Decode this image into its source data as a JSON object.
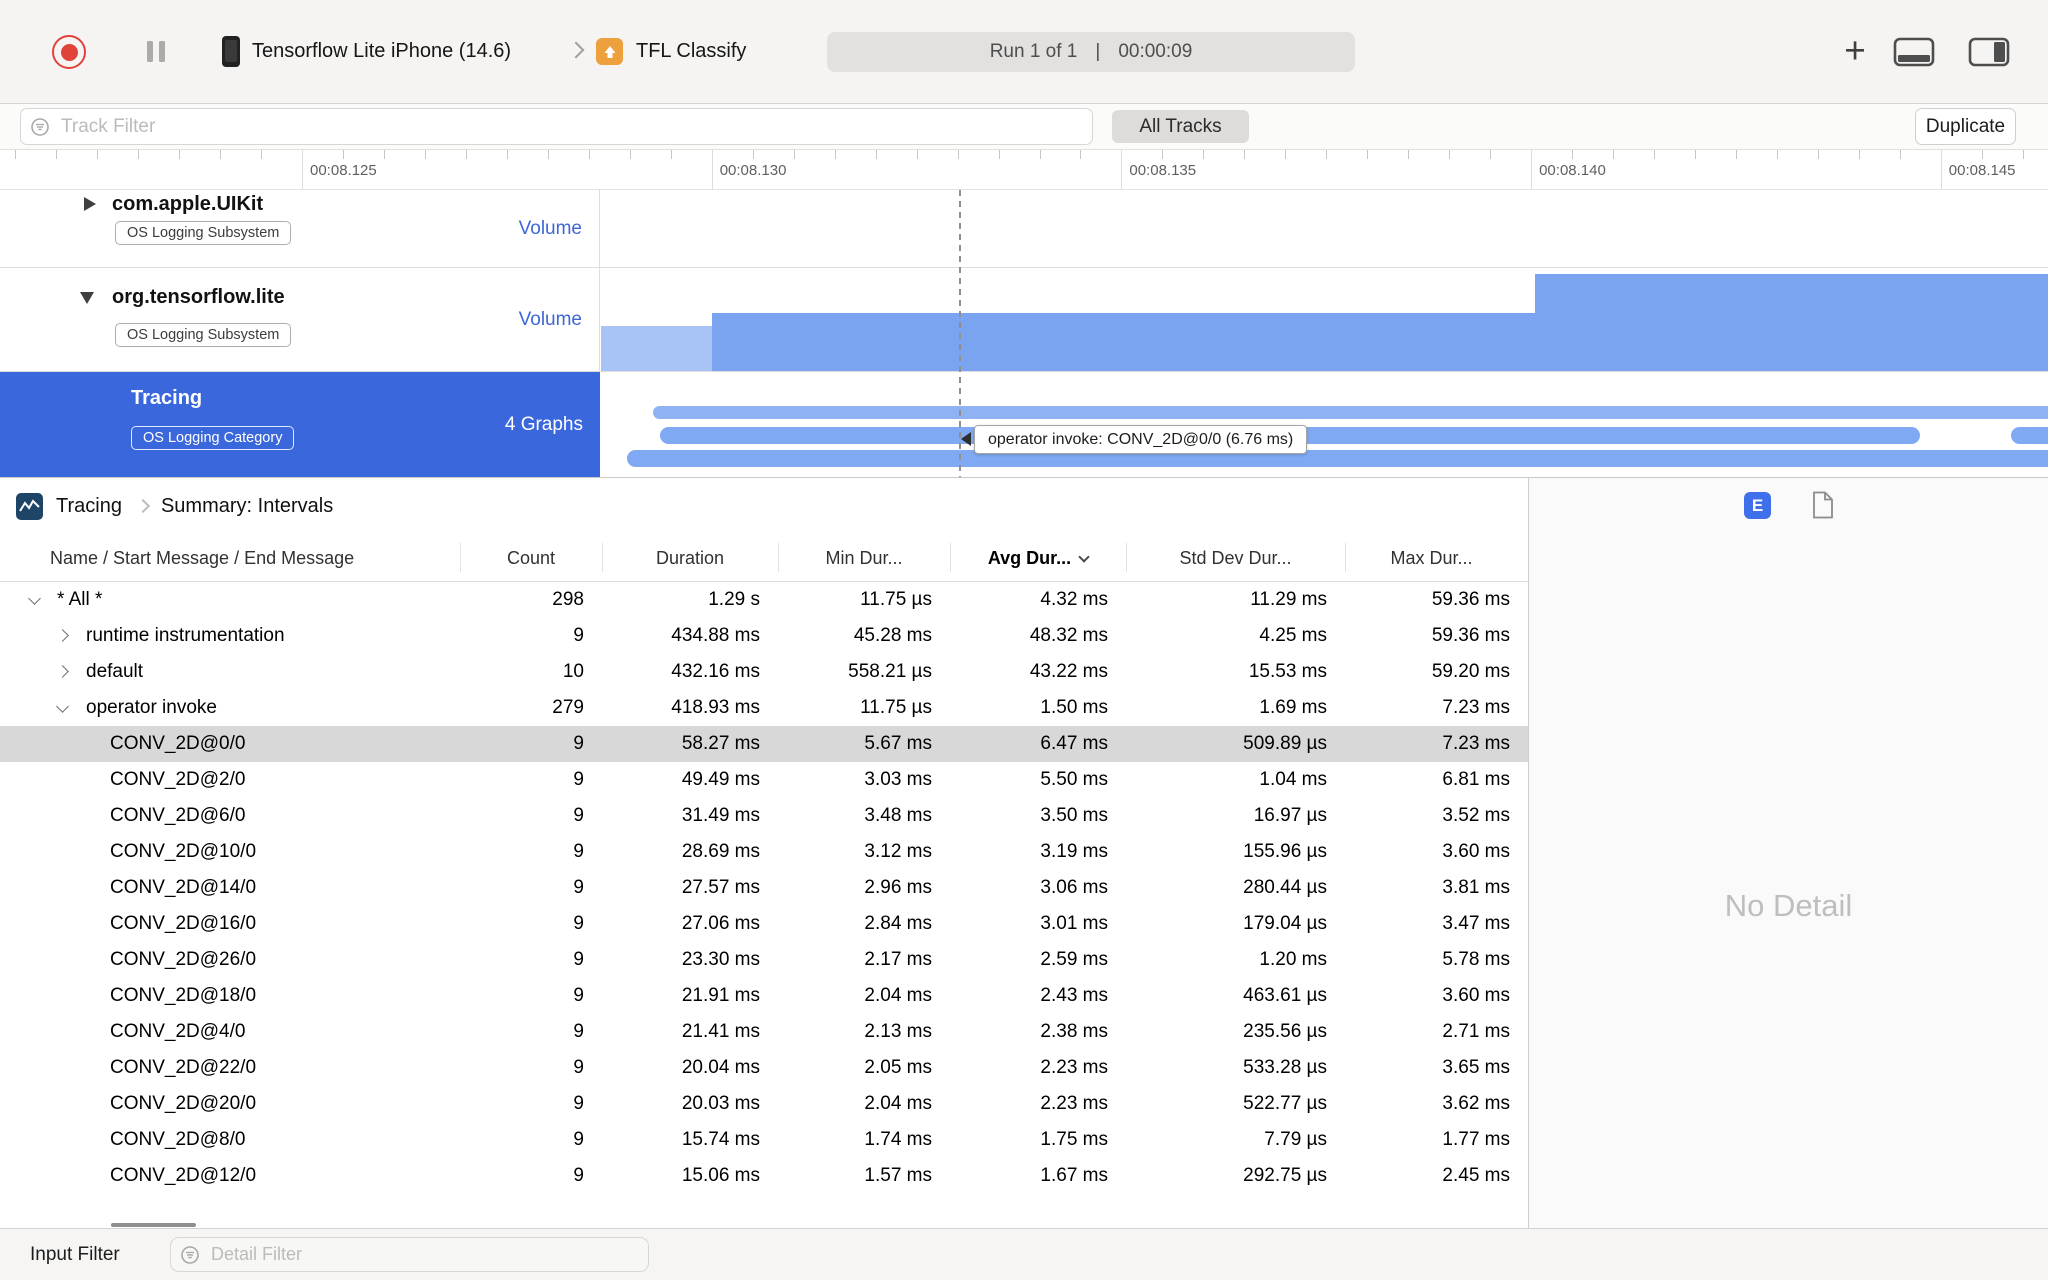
{
  "colors": {
    "selection_blue": "#3A67DB",
    "accent_blue": "#3E66D6",
    "chart_blue": "#7AA4F0",
    "chart_blue_light": "#A8C4F7",
    "interval_pill_blue": "#7FA9F3",
    "record_red": "#E0433A",
    "selected_row_gray": "#D8D8D8"
  },
  "toolbar": {
    "device_name": "Tensorflow Lite iPhone (14.6)",
    "instrument_name": "TFL Classify",
    "run_label": "Run 1 of 1",
    "run_separator": "|",
    "run_time": "00:00:09",
    "add_label": "+"
  },
  "filter_bar": {
    "track_filter_placeholder": "Track Filter",
    "all_tracks_button": "All Tracks",
    "duplicate_button": "Duplicate"
  },
  "timeline": {
    "ruler_labels": [
      "00:08.125",
      "00:08.130",
      "00:08.135",
      "00:08.140",
      "00:08.145"
    ],
    "tooltip": "operator invoke: CONV_2D@0/0 (6.76 ms)"
  },
  "tracks": [
    {
      "title": "com.apple.UIKit",
      "badge": "OS Logging Subsystem",
      "meta": "Volume",
      "disclosure": "collapsed",
      "selected": false
    },
    {
      "title": "org.tensorflow.lite",
      "badge": "OS Logging Subsystem",
      "meta": "Volume",
      "disclosure": "expanded",
      "selected": false
    },
    {
      "title": "Tracing",
      "badge": "OS Logging Category",
      "meta": "4 Graphs",
      "disclosure": "none",
      "selected": true
    }
  ],
  "detail_pane": {
    "breadcrumb": {
      "root": "Tracing",
      "page": "Summary: Intervals"
    },
    "e_button_label": "E",
    "no_detail": "No Detail",
    "table": {
      "columns": [
        "Name / Start Message / End Message",
        "Count",
        "Duration",
        "Min Dur...",
        "Avg Dur...",
        "Std Dev Dur...",
        "Max Dur..."
      ],
      "sorted_column": "Avg Dur...",
      "rows": [
        {
          "name": "* All *",
          "level": 1,
          "disclosure": "expanded",
          "selected": false,
          "count": "298",
          "duration": "1.29 s",
          "min": "11.75 µs",
          "avg": "4.32 ms",
          "stddev": "11.29 ms",
          "max": "59.36 ms"
        },
        {
          "name": "runtime instrumentation",
          "level": 2,
          "disclosure": "collapsed",
          "selected": false,
          "count": "9",
          "duration": "434.88 ms",
          "min": "45.28 ms",
          "avg": "48.32 ms",
          "stddev": "4.25 ms",
          "max": "59.36 ms"
        },
        {
          "name": "default",
          "level": 2,
          "disclosure": "collapsed",
          "selected": false,
          "count": "10",
          "duration": "432.16 ms",
          "min": "558.21 µs",
          "avg": "43.22 ms",
          "stddev": "15.53 ms",
          "max": "59.20 ms"
        },
        {
          "name": "operator invoke",
          "level": 2,
          "disclosure": "expanded",
          "selected": false,
          "count": "279",
          "duration": "418.93 ms",
          "min": "11.75 µs",
          "avg": "1.50 ms",
          "stddev": "1.69 ms",
          "max": "7.23 ms"
        },
        {
          "name": "CONV_2D@0/0",
          "level": 3,
          "disclosure": "none",
          "selected": true,
          "count": "9",
          "duration": "58.27 ms",
          "min": "5.67 ms",
          "avg": "6.47 ms",
          "stddev": "509.89 µs",
          "max": "7.23 ms"
        },
        {
          "name": "CONV_2D@2/0",
          "level": 3,
          "disclosure": "none",
          "selected": false,
          "count": "9",
          "duration": "49.49 ms",
          "min": "3.03 ms",
          "avg": "5.50 ms",
          "stddev": "1.04 ms",
          "max": "6.81 ms"
        },
        {
          "name": "CONV_2D@6/0",
          "level": 3,
          "disclosure": "none",
          "selected": false,
          "count": "9",
          "duration": "31.49 ms",
          "min": "3.48 ms",
          "avg": "3.50 ms",
          "stddev": "16.97 µs",
          "max": "3.52 ms"
        },
        {
          "name": "CONV_2D@10/0",
          "level": 3,
          "disclosure": "none",
          "selected": false,
          "count": "9",
          "duration": "28.69 ms",
          "min": "3.12 ms",
          "avg": "3.19 ms",
          "stddev": "155.96 µs",
          "max": "3.60 ms"
        },
        {
          "name": "CONV_2D@14/0",
          "level": 3,
          "disclosure": "none",
          "selected": false,
          "count": "9",
          "duration": "27.57 ms",
          "min": "2.96 ms",
          "avg": "3.06 ms",
          "stddev": "280.44 µs",
          "max": "3.81 ms"
        },
        {
          "name": "CONV_2D@16/0",
          "level": 3,
          "disclosure": "none",
          "selected": false,
          "count": "9",
          "duration": "27.06 ms",
          "min": "2.84 ms",
          "avg": "3.01 ms",
          "stddev": "179.04 µs",
          "max": "3.47 ms"
        },
        {
          "name": "CONV_2D@26/0",
          "level": 3,
          "disclosure": "none",
          "selected": false,
          "count": "9",
          "duration": "23.30 ms",
          "min": "2.17 ms",
          "avg": "2.59 ms",
          "stddev": "1.20 ms",
          "max": "5.78 ms"
        },
        {
          "name": "CONV_2D@18/0",
          "level": 3,
          "disclosure": "none",
          "selected": false,
          "count": "9",
          "duration": "21.91 ms",
          "min": "2.04 ms",
          "avg": "2.43 ms",
          "stddev": "463.61 µs",
          "max": "3.60 ms"
        },
        {
          "name": "CONV_2D@4/0",
          "level": 3,
          "disclosure": "none",
          "selected": false,
          "count": "9",
          "duration": "21.41 ms",
          "min": "2.13 ms",
          "avg": "2.38 ms",
          "stddev": "235.56 µs",
          "max": "2.71 ms"
        },
        {
          "name": "CONV_2D@22/0",
          "level": 3,
          "disclosure": "none",
          "selected": false,
          "count": "9",
          "duration": "20.04 ms",
          "min": "2.05 ms",
          "avg": "2.23 ms",
          "stddev": "533.28 µs",
          "max": "3.65 ms"
        },
        {
          "name": "CONV_2D@20/0",
          "level": 3,
          "disclosure": "none",
          "selected": false,
          "count": "9",
          "duration": "20.03 ms",
          "min": "2.04 ms",
          "avg": "2.23 ms",
          "stddev": "522.77 µs",
          "max": "3.62 ms"
        },
        {
          "name": "CONV_2D@8/0",
          "level": 3,
          "disclosure": "none",
          "selected": false,
          "count": "9",
          "duration": "15.74 ms",
          "min": "1.74 ms",
          "avg": "1.75 ms",
          "stddev": "7.79 µs",
          "max": "1.77 ms"
        },
        {
          "name": "CONV_2D@12/0",
          "level": 3,
          "disclosure": "none",
          "selected": false,
          "count": "9",
          "duration": "15.06 ms",
          "min": "1.57 ms",
          "avg": "1.67 ms",
          "stddev": "292.75 µs",
          "max": "2.45 ms"
        }
      ]
    }
  },
  "bottom_bar": {
    "input_filter_label": "Input Filter",
    "detail_filter_placeholder": "Detail Filter"
  }
}
